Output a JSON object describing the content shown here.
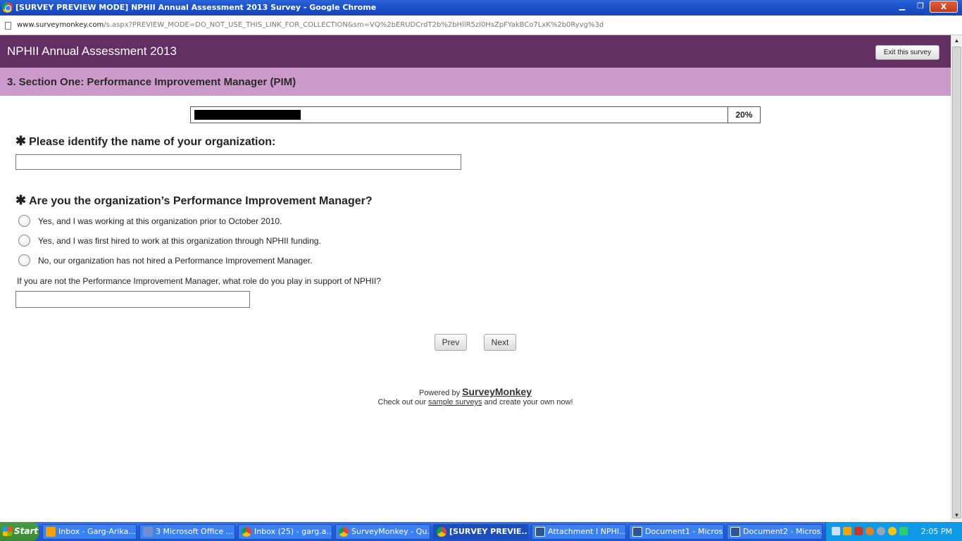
{
  "window": {
    "title": "[SURVEY PREVIEW MODE] NPHII Annual Assessment 2013 Survey - Google Chrome",
    "url_host": "www.surveymonkey.com",
    "url_path": "/s.aspx?PREVIEW_MODE=DO_NOT_USE_THIS_LINK_FOR_COLLECTION&sm=VQ%2bERUDCrdT2b%2bHllR5zl0HsZpFYakBCo7LxK%2b0Ryvg%3d",
    "minimize": "▁",
    "restore": "❐",
    "close": "X"
  },
  "survey": {
    "title": "NPHII Annual Assessment 2013",
    "exit_label": "Exit this survey",
    "section_title": "3. Section One: Performance Improvement Manager (PIM)",
    "progress_percent": 20,
    "progress_label": "20%"
  },
  "q1": {
    "required_mark": "✱",
    "text": "Please identify the name of your organization:",
    "value": ""
  },
  "q2": {
    "required_mark": "✱",
    "text": "Are you the organization’s Performance Improvement Manager?",
    "options": [
      "Yes, and I was working at this organization prior to October 2010.",
      "Yes, and I was first hired to work at this organization through NPHII funding.",
      "No, our organization has not hired a Performance Improvement Manager."
    ],
    "other_label": "If you are not the Performance Improvement Manager, what role do you play in support of NPHII?",
    "other_value": ""
  },
  "nav": {
    "prev": "Prev",
    "next": "Next"
  },
  "footer": {
    "powered_by": "Powered by",
    "brand": "SurveyMonkey",
    "check_out": "Check out our",
    "sample_link": "sample surveys",
    "create": "and create your own now!"
  },
  "scrollbar": {
    "up": "▲",
    "down": "▼"
  },
  "taskbar": {
    "start": "Start",
    "tasks": [
      "Inbox - Garg-Arika...",
      "3 Microsoft Office ...",
      "Inbox (25) - garg.a...",
      "SurveyMonkey - Qu...",
      "[SURVEY PREVIE...",
      "Attachment I  NPHI...",
      "Document1 - Micros...",
      "Document2 - Micros..."
    ],
    "clock": "2:05 PM"
  },
  "colors": {
    "header_purple": "#622f63",
    "section_lilac": "#cc99cb",
    "progress_fill": "#000000"
  }
}
